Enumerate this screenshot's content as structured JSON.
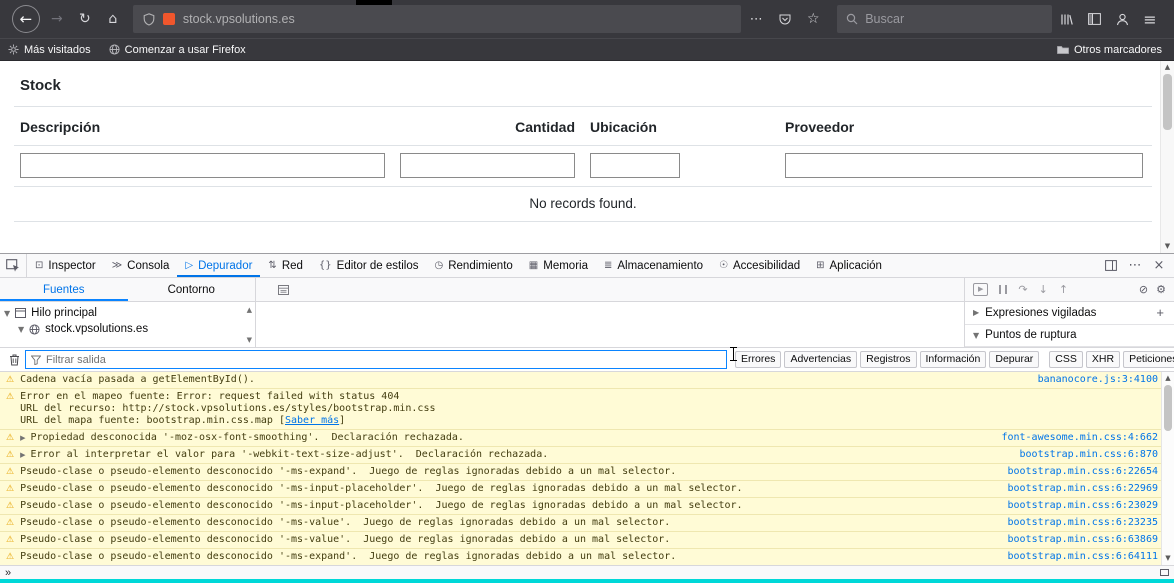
{
  "browser": {
    "toolbar": {
      "url": "stock.vpsolutions.es",
      "search_placeholder": "Buscar"
    },
    "bookmarks_bar": {
      "items": [
        {
          "label": "Más visitados",
          "icon": "pinwheel-icon"
        },
        {
          "label": "Comenzar a usar Firefox",
          "icon": "globe-icon"
        }
      ],
      "right_item": {
        "label": "Otros marcadores",
        "icon": "folder-icon"
      }
    }
  },
  "page": {
    "title": "Stock",
    "table": {
      "columns": [
        {
          "label": "Descripción",
          "align": "left"
        },
        {
          "label": "Cantidad",
          "align": "right"
        },
        {
          "label": "Ubicación",
          "align": "left"
        },
        {
          "label": "Proveedor",
          "align": "left"
        }
      ],
      "filter_values": [
        "",
        "",
        "",
        ""
      ],
      "empty_message": "No records found."
    }
  },
  "devtools": {
    "tabs": [
      {
        "label": "Inspector",
        "icon": "inspector-icon",
        "active": false
      },
      {
        "label": "Consola",
        "icon": "console-icon",
        "active": false
      },
      {
        "label": "Depurador",
        "icon": "debugger-icon",
        "active": true
      },
      {
        "label": "Red",
        "icon": "network-icon",
        "active": false
      },
      {
        "label": "Editor de estilos",
        "icon": "style-editor-icon",
        "active": false
      },
      {
        "label": "Rendimiento",
        "icon": "performance-icon",
        "active": false
      },
      {
        "label": "Memoria",
        "icon": "memory-icon",
        "active": false
      },
      {
        "label": "Almacenamiento",
        "icon": "storage-icon",
        "active": false
      },
      {
        "label": "Accesibilidad",
        "icon": "accessibility-icon",
        "active": false
      },
      {
        "label": "Aplicación",
        "icon": "application-icon",
        "active": false
      }
    ],
    "debugger": {
      "panel_tabs": [
        {
          "label": "Fuentes",
          "active": true
        },
        {
          "label": "Contorno",
          "active": false
        }
      ],
      "source_tree": [
        {
          "label": "Hilo principal",
          "icon": "window-icon",
          "level": 0
        },
        {
          "label": "stock.vpsolutions.es",
          "icon": "globe-icon",
          "level": 1
        }
      ],
      "right_panels": [
        {
          "label": "Expresiones vigiladas",
          "collapsed": true,
          "action": "+"
        },
        {
          "label": "Puntos de ruptura",
          "collapsed": false
        }
      ]
    },
    "console": {
      "filter_placeholder": "Filtrar salida",
      "filter_groups": [
        [
          "Errores",
          "Advertencias",
          "Registros",
          "Información",
          "Depurar"
        ],
        [
          "CSS",
          "XHR",
          "Peticiones"
        ]
      ],
      "messages": [
        {
          "type": "warning",
          "text": "Cadena vacía pasada a getElementById().",
          "source": "bananocore.js:3:4100"
        },
        {
          "type": "warning",
          "lines": [
            "Error en el mapeo fuente: Error: request failed with status 404",
            "URL del recurso: http://stock.vpsolutions.es/styles/bootstrap.min.css",
            "URL del mapa fuente: bootstrap.min.css.map"
          ],
          "link": "Saber más"
        },
        {
          "type": "warning",
          "expandable": true,
          "text": "Propiedad desconocida '-moz-osx-font-smoothing'.  Declaración rechazada.",
          "source": "font-awesome.min.css:4:662"
        },
        {
          "type": "warning",
          "expandable": true,
          "text": "Error al interpretar el valor para '-webkit-text-size-adjust'.  Declaración rechazada.",
          "source": "bootstrap.min.css:6:870"
        },
        {
          "type": "warning",
          "text": "Pseudo-clase o pseudo-elemento desconocido '-ms-expand'.  Juego de reglas ignoradas debido a un mal selector.",
          "source": "bootstrap.min.css:6:22654"
        },
        {
          "type": "warning",
          "text": "Pseudo-clase o pseudo-elemento desconocido '-ms-input-placeholder'.  Juego de reglas ignoradas debido a un mal selector.",
          "source": "bootstrap.min.css:6:22969"
        },
        {
          "type": "warning",
          "text": "Pseudo-clase o pseudo-elemento desconocido '-ms-input-placeholder'.  Juego de reglas ignoradas debido a un mal selector.",
          "source": "bootstrap.min.css:6:23029"
        },
        {
          "type": "warning",
          "text": "Pseudo-clase o pseudo-elemento desconocido '-ms-value'.  Juego de reglas ignoradas debido a un mal selector.",
          "source": "bootstrap.min.css:6:23235"
        },
        {
          "type": "warning",
          "text": "Pseudo-clase o pseudo-elemento desconocido '-ms-value'.  Juego de reglas ignoradas debido a un mal selector.",
          "source": "bootstrap.min.css:6:63869"
        },
        {
          "type": "warning",
          "text": "Pseudo-clase o pseudo-elemento desconocido '-ms-expand'.  Juego de reglas ignoradas debido a un mal selector.",
          "source": "bootstrap.min.css:6:64111"
        }
      ]
    },
    "footer": {
      "expand_label": "»"
    }
  },
  "colors": {
    "accent_blue": "#0074e8",
    "warning_bg": "#fffbd6",
    "toolbar_dark": "#38383d",
    "filter_focus_border": "#0a84ff",
    "bottom_strip": "#00d8d8"
  }
}
